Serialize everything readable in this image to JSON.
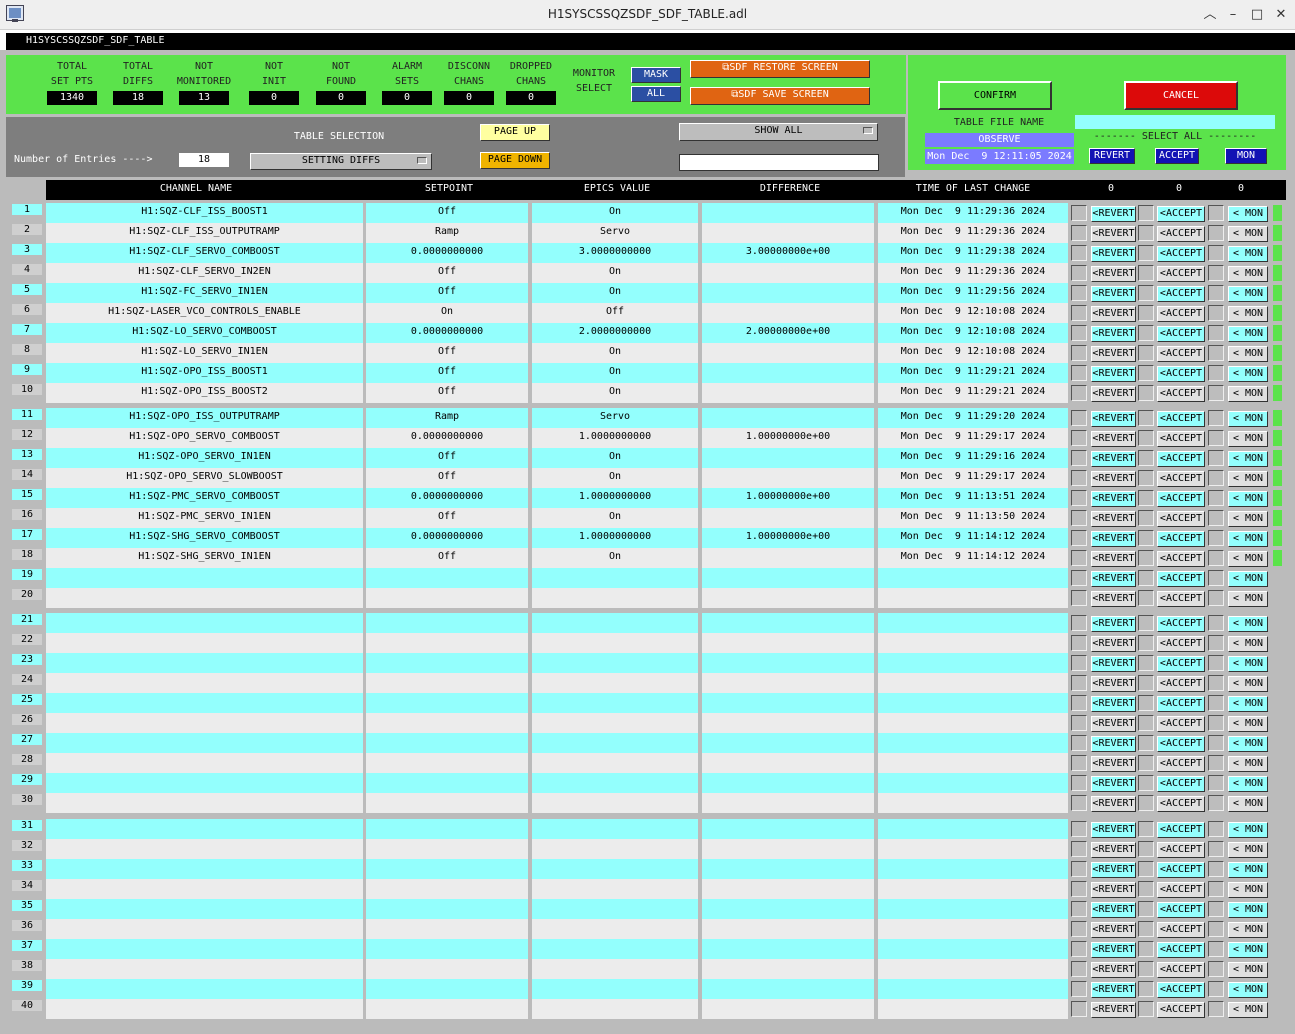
{
  "window": {
    "title": "H1SYSCSSQZSDF_SDF_TABLE.adl",
    "header": "H1SYSCSSQZSDF_SDF_TABLE"
  },
  "colors": {
    "green": "#5be34b",
    "cyan": "#93fffd",
    "gray_row": "#ececec",
    "accent_blue": "#2f4bdc",
    "orange": "#e06412",
    "red": "#dc0a0a"
  },
  "summary": [
    {
      "label": "TOTAL\nSET PTS",
      "value": "1340"
    },
    {
      "label": "TOTAL\nDIFFS",
      "value": "18"
    },
    {
      "label": "NOT\nMONITORED",
      "value": "13"
    },
    {
      "label": "NOT\nINIT",
      "value": "0"
    },
    {
      "label": "NOT\nFOUND",
      "value": "0"
    },
    {
      "label": "ALARM\nSETS",
      "value": "0"
    },
    {
      "label": "DISCONN\nCHANS",
      "value": "0"
    },
    {
      "label": "DROPPED\nCHANS",
      "value": "0"
    }
  ],
  "monitor": {
    "label": "MONITOR\nSELECT",
    "mask": "MASK",
    "all": "ALL"
  },
  "restore_btn": "SDF RESTORE SCREEN",
  "save_btn": "SDF SAVE SCREEN",
  "confirm": {
    "confirm": "CONFIRM",
    "cancel": "CANCEL",
    "table_file_label": "TABLE FILE NAME",
    "observe": "OBSERVE",
    "datetime": "Mon Dec  9 12:11:05 2024",
    "select_all": "------- SELECT ALL --------",
    "revert": "REVERT",
    "accept": "ACCEPT",
    "mon": "MON"
  },
  "selection": {
    "entries_label": "Number of Entries ---->",
    "entries": "18",
    "table_sel_label": "TABLE SELECTION",
    "table_sel": "SETTING DIFFS",
    "page_up": "PAGE UP",
    "page_down": "PAGE DOWN",
    "show": "SHOW ALL"
  },
  "columns": {
    "name": "CHANNEL NAME",
    "setpoint": "SETPOINT",
    "epics": "EPICS VALUE",
    "diff": "DIFFERENCE",
    "time": "TIME OF LAST CHANGE",
    "c1": "0",
    "c2": "0",
    "c3": "0"
  },
  "row_btn": {
    "revert": "<REVERT",
    "accept": "<ACCEPT",
    "mon": "< MON"
  },
  "rows": [
    [
      "H1:SQZ-CLF_ISS_BOOST1",
      "Off",
      "On",
      "",
      "Mon Dec  9 11:29:36 2024"
    ],
    [
      "H1:SQZ-CLF_ISS_OUTPUTRAMP",
      "Ramp",
      "Servo",
      "",
      "Mon Dec  9 11:29:36 2024"
    ],
    [
      "H1:SQZ-CLF_SERVO_COMBOOST",
      "0.0000000000",
      "3.0000000000",
      "3.00000000e+00",
      "Mon Dec  9 11:29:38 2024"
    ],
    [
      "H1:SQZ-CLF_SERVO_IN2EN",
      "Off",
      "On",
      "",
      "Mon Dec  9 11:29:36 2024"
    ],
    [
      "H1:SQZ-FC_SERVO_IN1EN",
      "Off",
      "On",
      "",
      "Mon Dec  9 11:29:56 2024"
    ],
    [
      "H1:SQZ-LASER_VCO_CONTROLS_ENABLE",
      "On",
      "Off",
      "",
      "Mon Dec  9 12:10:08 2024"
    ],
    [
      "H1:SQZ-LO_SERVO_COMBOOST",
      "0.0000000000",
      "2.0000000000",
      "2.00000000e+00",
      "Mon Dec  9 12:10:08 2024"
    ],
    [
      "H1:SQZ-LO_SERVO_IN1EN",
      "Off",
      "On",
      "",
      "Mon Dec  9 12:10:08 2024"
    ],
    [
      "H1:SQZ-OPO_ISS_BOOST1",
      "Off",
      "On",
      "",
      "Mon Dec  9 11:29:21 2024"
    ],
    [
      "H1:SQZ-OPO_ISS_BOOST2",
      "Off",
      "On",
      "",
      "Mon Dec  9 11:29:21 2024"
    ],
    [
      "H1:SQZ-OPO_ISS_OUTPUTRAMP",
      "Ramp",
      "Servo",
      "",
      "Mon Dec  9 11:29:20 2024"
    ],
    [
      "H1:SQZ-OPO_SERVO_COMBOOST",
      "0.0000000000",
      "1.0000000000",
      "1.00000000e+00",
      "Mon Dec  9 11:29:17 2024"
    ],
    [
      "H1:SQZ-OPO_SERVO_IN1EN",
      "Off",
      "On",
      "",
      "Mon Dec  9 11:29:16 2024"
    ],
    [
      "H1:SQZ-OPO_SERVO_SLOWBOOST",
      "Off",
      "On",
      "",
      "Mon Dec  9 11:29:17 2024"
    ],
    [
      "H1:SQZ-PMC_SERVO_COMBOOST",
      "0.0000000000",
      "1.0000000000",
      "1.00000000e+00",
      "Mon Dec  9 11:13:51 2024"
    ],
    [
      "H1:SQZ-PMC_SERVO_IN1EN",
      "Off",
      "On",
      "",
      "Mon Dec  9 11:13:50 2024"
    ],
    [
      "H1:SQZ-SHG_SERVO_COMBOOST",
      "0.0000000000",
      "1.0000000000",
      "1.00000000e+00",
      "Mon Dec  9 11:14:12 2024"
    ],
    [
      "H1:SQZ-SHG_SERVO_IN1EN",
      "Off",
      "On",
      "",
      "Mon Dec  9 11:14:12 2024"
    ]
  ]
}
